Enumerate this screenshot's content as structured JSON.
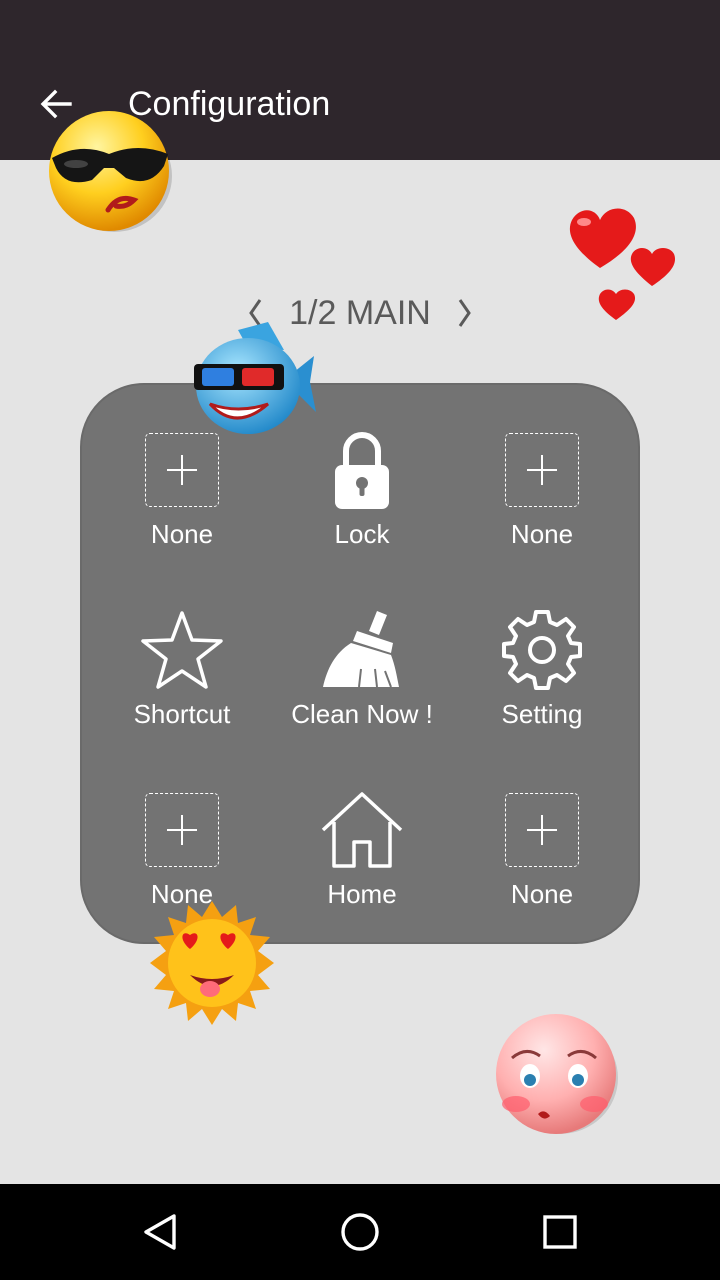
{
  "app_bar": {
    "title": "Configuration"
  },
  "pager": {
    "label": "1/2 MAIN"
  },
  "grid": {
    "items": [
      {
        "label": "None",
        "icon": "plus-icon"
      },
      {
        "label": "Lock",
        "icon": "lock-icon"
      },
      {
        "label": "None",
        "icon": "plus-icon"
      },
      {
        "label": "Shortcut",
        "icon": "star-icon"
      },
      {
        "label": "Clean Now !",
        "icon": "broom-icon"
      },
      {
        "label": "Setting",
        "icon": "gear-icon"
      },
      {
        "label": "None",
        "icon": "plus-icon"
      },
      {
        "label": "Home",
        "icon": "home-icon"
      },
      {
        "label": "None",
        "icon": "plus-icon"
      }
    ]
  },
  "colors": {
    "app_bar": "#2e262c",
    "panel": "#737373",
    "background": "#e4e4e4",
    "nav_bar": "#000000"
  },
  "stickers": [
    "cool-sunglasses-emoji",
    "hearts-sticker",
    "fish-3d-glasses-sticker",
    "sun-heart-eyes-sticker",
    "blushing-emoji"
  ],
  "nav": {
    "icons": [
      "back-triangle-icon",
      "home-circle-icon",
      "recents-square-icon"
    ]
  }
}
